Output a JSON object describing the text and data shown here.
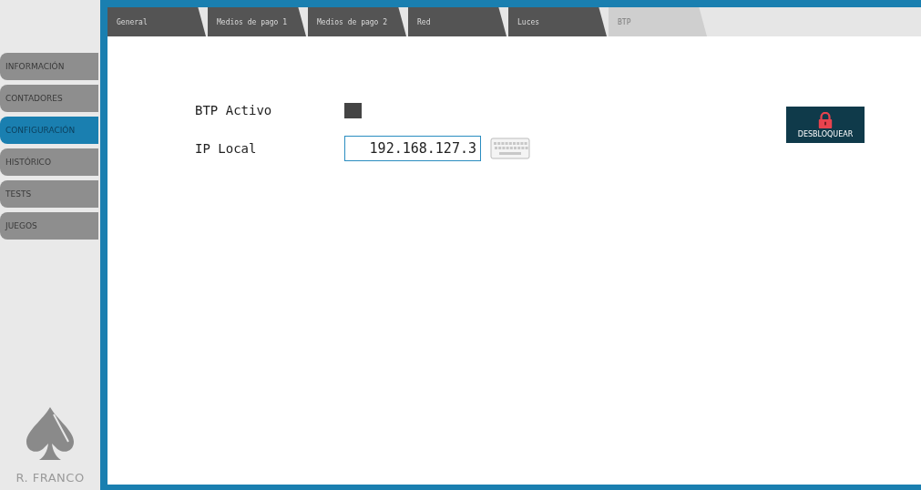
{
  "sidebar": {
    "items": [
      {
        "label": "INFORMACIÓN",
        "selected": false
      },
      {
        "label": "CONTADORES",
        "selected": false
      },
      {
        "label": "CONFIGURACIÓN",
        "selected": true
      },
      {
        "label": "HISTÓRICO",
        "selected": false
      },
      {
        "label": "TESTS",
        "selected": false
      },
      {
        "label": "JUEGOS",
        "selected": false
      }
    ],
    "brand": "R. FRANCO"
  },
  "tabs": [
    {
      "label": "General",
      "selected": false
    },
    {
      "label": "Medios de pago 1",
      "selected": false
    },
    {
      "label": "Medios de pago 2",
      "selected": false
    },
    {
      "label": "Red",
      "selected": false
    },
    {
      "label": "Luces",
      "selected": false
    },
    {
      "label": "BTP",
      "selected": true
    }
  ],
  "form": {
    "btp_active": {
      "label": "BTP Activo",
      "checked": true
    },
    "ip_local": {
      "label": "IP Local",
      "value": "192.168.127.3"
    }
  },
  "unlock_button": {
    "label": "DESBLOQUEAR"
  }
}
